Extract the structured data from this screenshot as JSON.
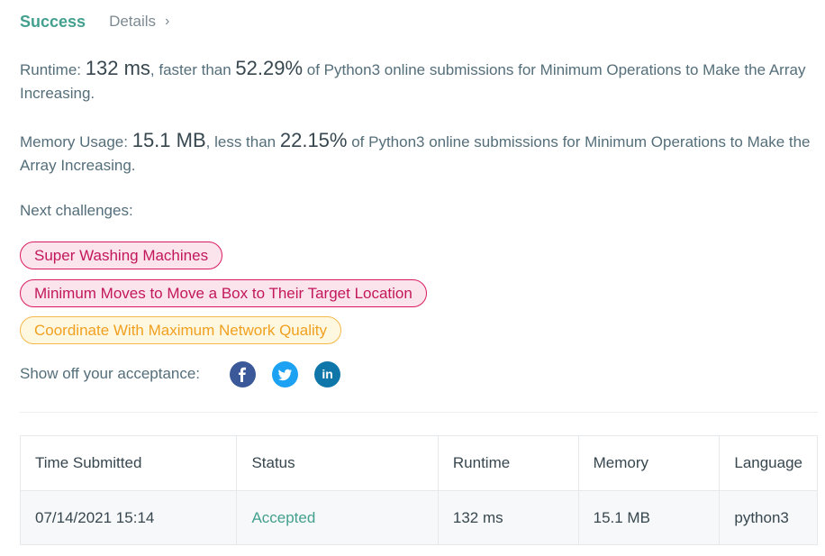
{
  "header": {
    "status": "Success",
    "details_label": "Details",
    "details_chevron": "›"
  },
  "runtime": {
    "label": "Runtime: ",
    "value": "132 ms",
    "comparison": ", faster than ",
    "percent": "52.29%",
    "description": " of Python3 online submissions for Minimum Operations to Make the Array Increasing."
  },
  "memory": {
    "label": "Memory Usage: ",
    "value": "15.1 MB",
    "comparison": ", less than ",
    "percent": "22.15%",
    "description": " of Python3 online submissions for Minimum Operations to Make the Array Increasing."
  },
  "next_challenges": {
    "label": "Next challenges:",
    "items": [
      {
        "title": "Super Washing Machines",
        "difficulty": "hard",
        "color": "#c2185b"
      },
      {
        "title": "Minimum Moves to Move a Box to Their Target Location",
        "difficulty": "hard",
        "color": "#c2185b"
      },
      {
        "title": "Coordinate With Maximum Network Quality",
        "difficulty": "medium",
        "color": "#f0a020"
      }
    ]
  },
  "share": {
    "label": "Show off your acceptance:",
    "icons": [
      {
        "name": "facebook-icon",
        "glyph": "f",
        "color": "#3b5998"
      },
      {
        "name": "twitter-icon",
        "glyph": "t",
        "color": "#1da1f2"
      },
      {
        "name": "linkedin-icon",
        "glyph": "in",
        "color": "#0e76a8"
      }
    ]
  },
  "table": {
    "headers": [
      "Time Submitted",
      "Status",
      "Runtime",
      "Memory",
      "Language"
    ],
    "rows": [
      {
        "time": "07/14/2021 15:14",
        "status": "Accepted",
        "runtime": "132 ms",
        "memory": "15.1 MB",
        "language": "python3"
      }
    ]
  },
  "colors": {
    "accent": "#43a08e",
    "text": "#546e7a"
  }
}
